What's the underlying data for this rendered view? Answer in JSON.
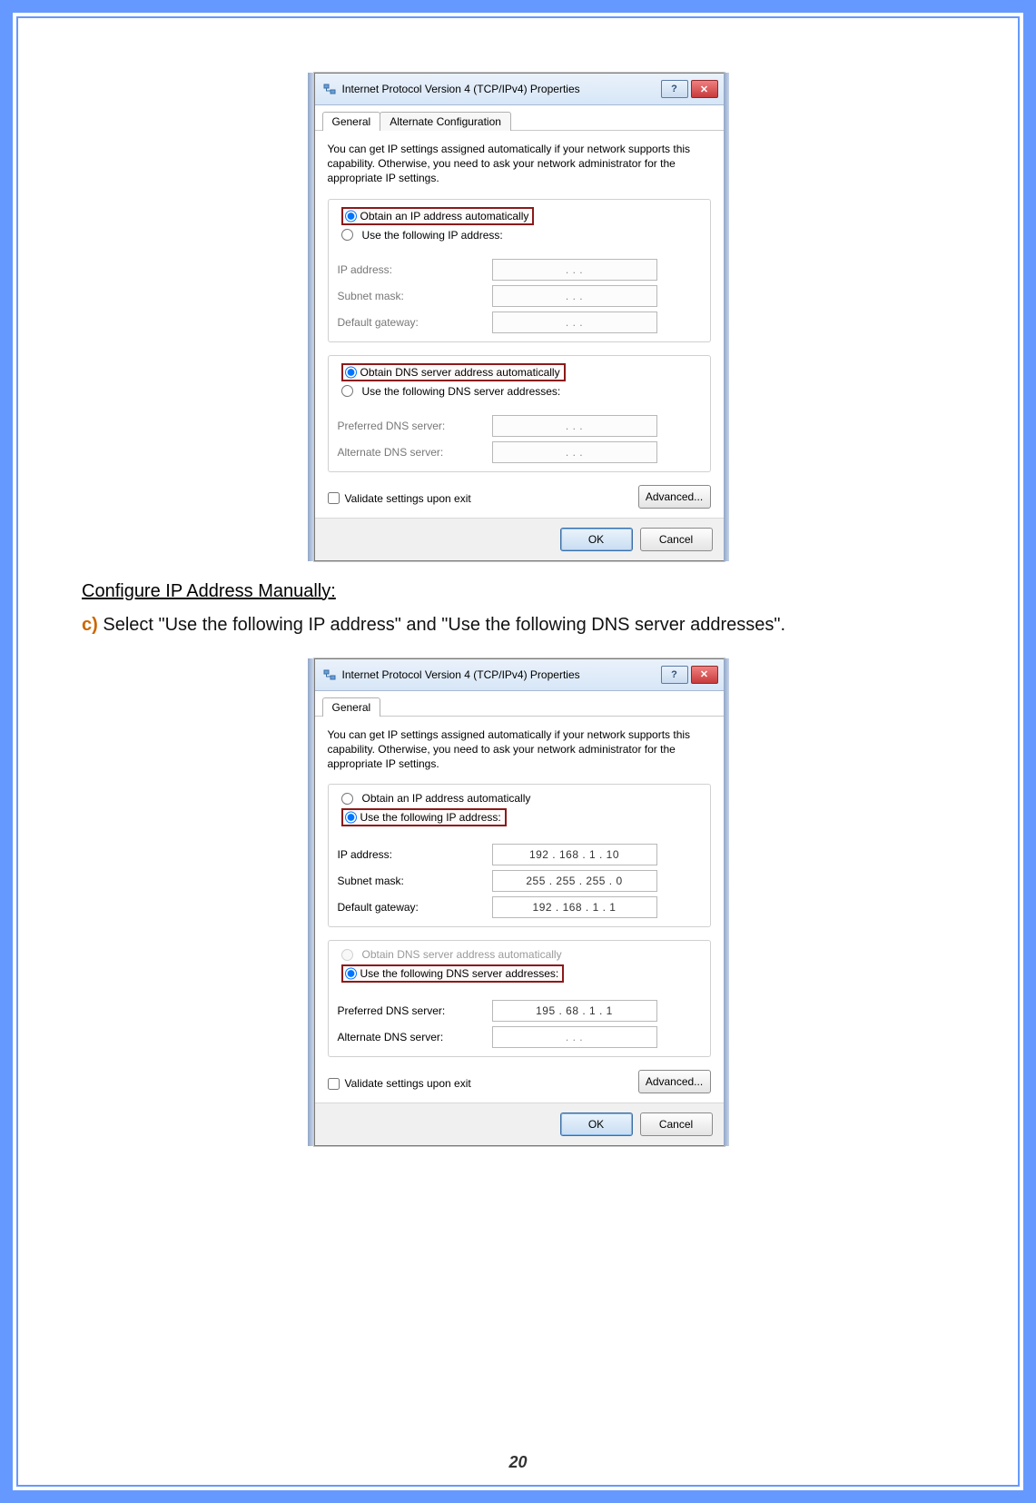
{
  "dialog1": {
    "title": "Internet Protocol Version 4 (TCP/IPv4) Properties",
    "tabs": [
      "General",
      "Alternate Configuration"
    ],
    "description": "You can get IP settings assigned automatically if your network supports this capability. Otherwise, you need to ask your network administrator for the appropriate IP settings.",
    "radio_obtain_ip": "Obtain an IP address automatically",
    "radio_use_ip": "Use the following IP address:",
    "lbl_ip": "IP address:",
    "lbl_subnet": "Subnet mask:",
    "lbl_gateway": "Default gateway:",
    "radio_obtain_dns": "Obtain DNS server address automatically",
    "radio_use_dns": "Use the following DNS server addresses:",
    "lbl_pref_dns": "Preferred DNS server:",
    "lbl_alt_dns": "Alternate DNS server:",
    "chk_validate": "Validate settings upon exit",
    "btn_advanced": "Advanced...",
    "btn_ok": "OK",
    "btn_cancel": "Cancel"
  },
  "doc": {
    "heading": "Configure IP Address Manually:",
    "step_marker": "c)",
    "step_text": " Select \"Use the following IP address\" and \"Use the following DNS server addresses\"."
  },
  "dialog2": {
    "title": "Internet Protocol Version 4 (TCP/IPv4) Properties",
    "tabs": [
      "General"
    ],
    "description": "You can get IP settings assigned automatically if your network supports this capability. Otherwise, you need to ask your network administrator for the appropriate IP settings.",
    "radio_obtain_ip": "Obtain an IP address automatically",
    "radio_use_ip": "Use the following IP address:",
    "lbl_ip": "IP address:",
    "lbl_subnet": "Subnet mask:",
    "lbl_gateway": "Default gateway:",
    "val_ip": "192 . 168 .  1  .  10",
    "val_subnet": "255 . 255 . 255 .  0",
    "val_gateway": "192 . 168 .  1  .  1",
    "radio_obtain_dns": "Obtain DNS server address automatically",
    "radio_use_dns": "Use the following DNS server addresses:",
    "lbl_pref_dns": "Preferred DNS server:",
    "lbl_alt_dns": "Alternate DNS server:",
    "val_pref_dns": "195 .  68 .  1  .  1",
    "chk_validate": "Validate settings upon exit",
    "btn_advanced": "Advanced...",
    "btn_ok": "OK",
    "btn_cancel": "Cancel"
  },
  "page_number": "20",
  "ip_placeholder": ".       .       ."
}
